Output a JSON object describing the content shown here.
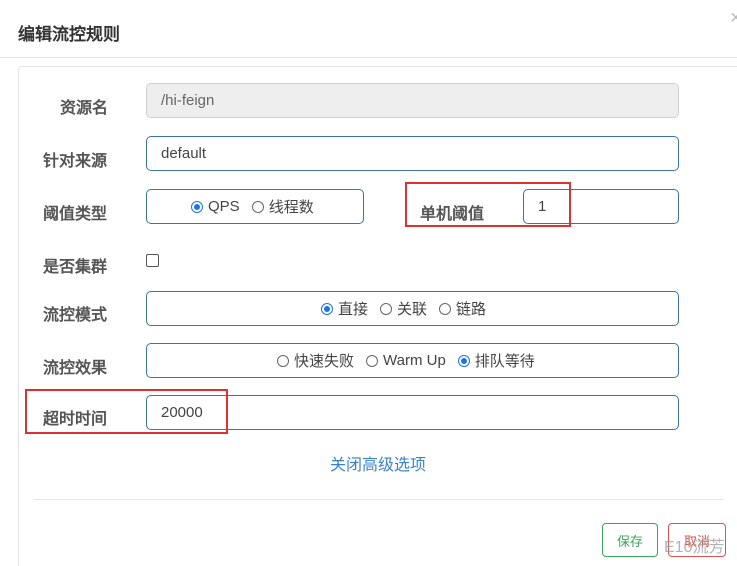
{
  "dialog": {
    "title": "编辑流控规则",
    "close": "×"
  },
  "form": {
    "resource": {
      "label": "资源名",
      "value": "/hi-feign"
    },
    "limitApp": {
      "label": "针对来源",
      "value": "default"
    },
    "grade": {
      "label": "阈值类型",
      "options": [
        "QPS",
        "线程数"
      ],
      "selected": "QPS"
    },
    "count": {
      "label": "单机阈值",
      "value": "1"
    },
    "cluster": {
      "label": "是否集群",
      "checked": false
    },
    "strategy": {
      "label": "流控模式",
      "options": [
        "直接",
        "关联",
        "链路"
      ],
      "selected": "直接"
    },
    "controlBehavior": {
      "label": "流控效果",
      "options": [
        "快速失败",
        "Warm Up",
        "排队等待"
      ],
      "selected": "排队等待"
    },
    "timeout": {
      "label": "超时时间",
      "value": "20000"
    },
    "advanced_link": "关闭高级选项"
  },
  "footer": {
    "save_label": "保存",
    "cancel_label": "取消"
  },
  "watermark": "E10流芳"
}
